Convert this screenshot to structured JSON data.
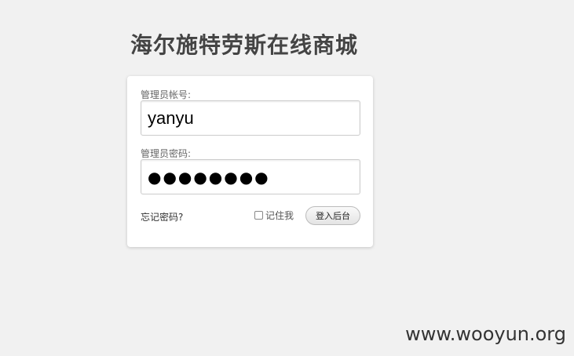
{
  "header": {
    "title": "海尔施特劳斯在线商城"
  },
  "login_form": {
    "username_label": "管理员帐号:",
    "username_value": "yanyu",
    "password_label": "管理员密码:",
    "password_masked": "●●●●●●●●",
    "forgot_link": "忘记密码?",
    "remember_label": "记住我",
    "remember_checked": false,
    "submit_label": "登入后台"
  },
  "watermark": {
    "text": "www.wooyun.org"
  }
}
